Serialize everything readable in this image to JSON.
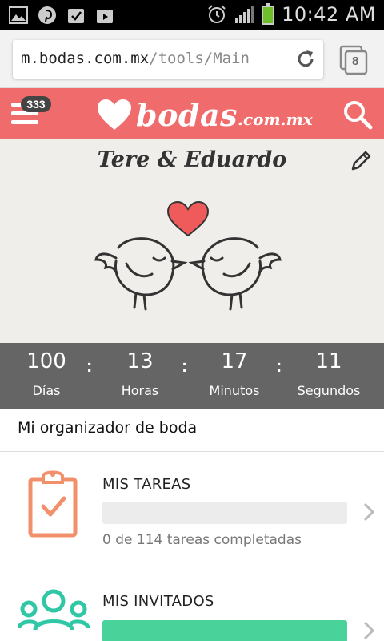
{
  "status_bar": {
    "time": "10:42 AM",
    "left_icons": [
      "gallery-icon",
      "pinterest-icon",
      "checkbox-icon",
      "play-store-icon"
    ],
    "right_icons": [
      "alarm-icon",
      "signal-icon",
      "battery-icon"
    ]
  },
  "browser": {
    "url_host": "m.bodas.com.mx",
    "url_path": "/tools/Main",
    "tab_count": "8"
  },
  "header": {
    "badge_count": "333",
    "logo_text": "bodas",
    "logo_suffix": ".com.mx",
    "brand_color": "#f06b6b"
  },
  "hero": {
    "couple_names": "Tere & Eduardo"
  },
  "countdown": {
    "units": [
      {
        "value": "100",
        "label": "Días"
      },
      {
        "value": "13",
        "label": "Horas"
      },
      {
        "value": "17",
        "label": "Minutos"
      },
      {
        "value": "11",
        "label": "Segundos"
      }
    ],
    "separator": ":"
  },
  "organizer": {
    "title": "Mi organizador de boda",
    "cards": [
      {
        "title": "MIS TAREAS",
        "subtitle": "0 de 114 tareas completadas",
        "progress": 0,
        "icon": "clipboard-check-icon",
        "icon_color": "#f2906c"
      },
      {
        "title": "MIS INVITADOS",
        "subtitle": "",
        "progress": 1.0,
        "icon": "guests-group-icon",
        "icon_color": "#2fc7a5"
      }
    ]
  }
}
